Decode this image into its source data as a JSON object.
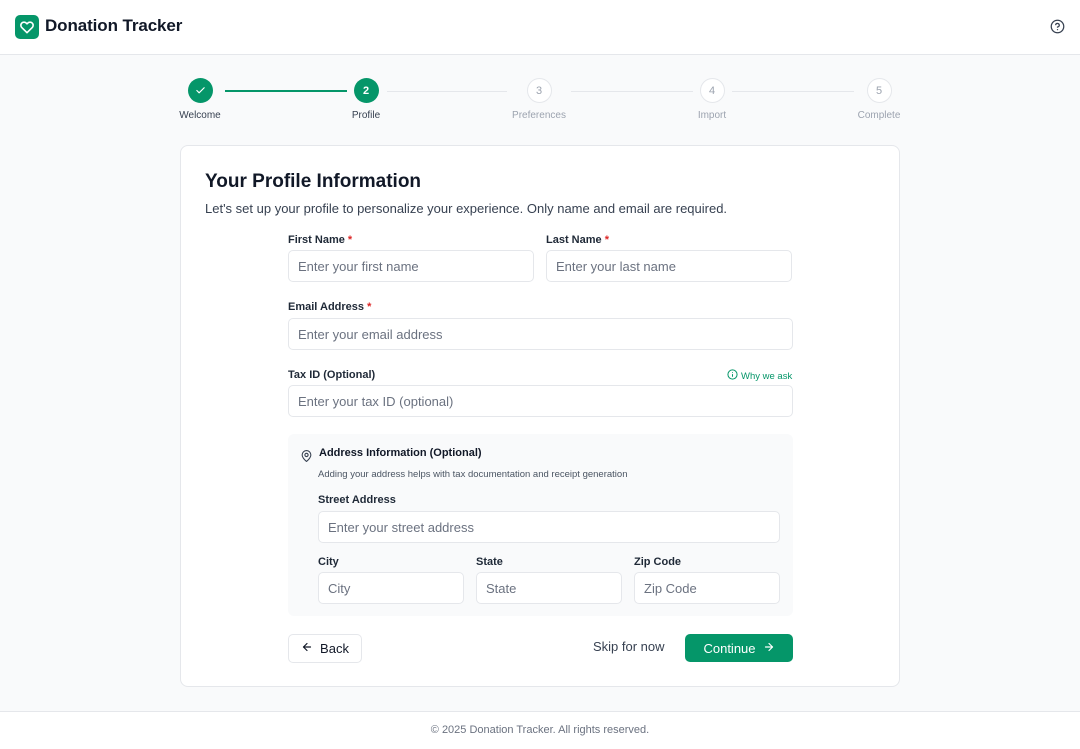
{
  "app": {
    "title": "Donation Tracker"
  },
  "stepper": {
    "steps": [
      {
        "number": "1",
        "label": "Welcome",
        "state": "done"
      },
      {
        "number": "2",
        "label": "Profile",
        "state": "active"
      },
      {
        "number": "3",
        "label": "Preferences",
        "state": "pending"
      },
      {
        "number": "4",
        "label": "Import",
        "state": "pending"
      },
      {
        "number": "5",
        "label": "Complete",
        "state": "pending"
      }
    ]
  },
  "form": {
    "title": "Your Profile Information",
    "subtitle": "Let's set up your profile to personalize your experience. Only name and email are required.",
    "required_marker": "*",
    "first_name": {
      "label": "First Name",
      "placeholder": "Enter your first name",
      "value": ""
    },
    "last_name": {
      "label": "Last Name",
      "placeholder": "Enter your last name",
      "value": ""
    },
    "email": {
      "label": "Email Address",
      "placeholder": "Enter your email address",
      "value": ""
    },
    "tax_id": {
      "label": "Tax ID (Optional)",
      "placeholder": "Enter your tax ID (optional)",
      "value": "",
      "help_link": "Why we ask"
    },
    "address": {
      "title": "Address Information (Optional)",
      "note": "Adding your address helps with tax documentation and receipt generation",
      "street": {
        "label": "Street Address",
        "placeholder": "Enter your street address",
        "value": ""
      },
      "city": {
        "label": "City",
        "placeholder": "City",
        "value": ""
      },
      "state": {
        "label": "State",
        "placeholder": "State",
        "value": ""
      },
      "zip": {
        "label": "Zip Code",
        "placeholder": "Zip Code",
        "value": ""
      }
    },
    "actions": {
      "back": "Back",
      "skip": "Skip for now",
      "continue": "Continue"
    }
  },
  "footer": {
    "text": "© 2025 Donation Tracker. All rights reserved."
  },
  "icons": {
    "logo": "heart-icon",
    "help": "help-circle-icon",
    "check": "check-icon",
    "info": "info-icon",
    "location": "map-pin-icon",
    "back": "arrow-left-icon",
    "continue": "arrow-right-icon"
  },
  "colors": {
    "accent": "#059669",
    "required": "#dc2626",
    "border": "#e5e7eb",
    "background": "#f9fafb",
    "muted_text": "#6b7280"
  }
}
